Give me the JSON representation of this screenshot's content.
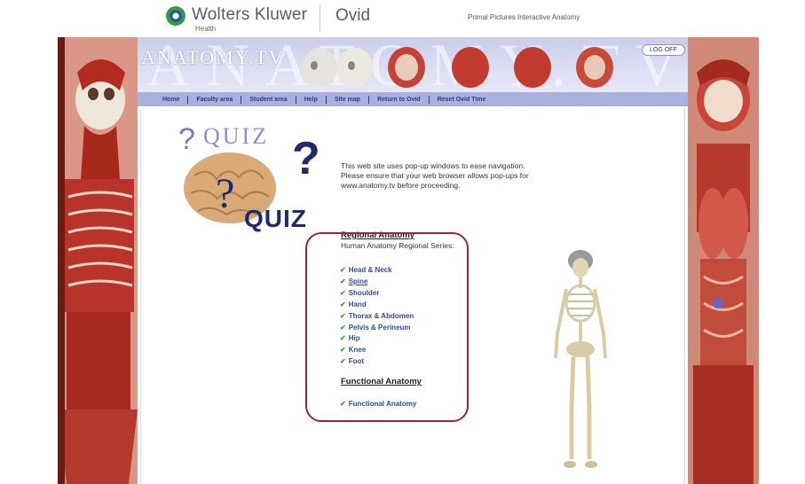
{
  "brand": {
    "company": "Wolters Kluwer",
    "company_sub": "Health",
    "platform": "Ovid",
    "product_title": "Primal Pictures Interactive Anatomy"
  },
  "banner": {
    "title": "ANATOMY.TV",
    "logoff_label": "LOG OFF"
  },
  "nav": {
    "items": [
      "Home",
      "Faculty area",
      "Student area",
      "Help",
      "Site map",
      "Return to Ovid",
      "Reset Ovid Time"
    ]
  },
  "quiz": {
    "top_word": "QUIZ",
    "bottom_word": "QUIZ"
  },
  "intro": {
    "text": "This web site uses pop-up windows to ease navigation. Please ensure that your web browser allows pop-ups for www.anatomy.tv before proceeding."
  },
  "regional": {
    "heading": "Regional Anatomy",
    "subheading": "Human Anatomy Regional Series:",
    "items": [
      "Head & Neck",
      "Spine",
      "Shoulder",
      "Hand",
      "Thorax & Abdomen",
      "Pelvis & Perineum",
      "Hip",
      "Knee",
      "Foot"
    ]
  },
  "functional": {
    "heading": "Functional Anatomy",
    "link": "Functional Anatomy"
  },
  "colors": {
    "nav_bg": "#a9b0dd",
    "nav_text": "#2f3a8c",
    "link": "#2f4aa0",
    "check": "#3aa33a",
    "highlight": "#a3232f"
  }
}
